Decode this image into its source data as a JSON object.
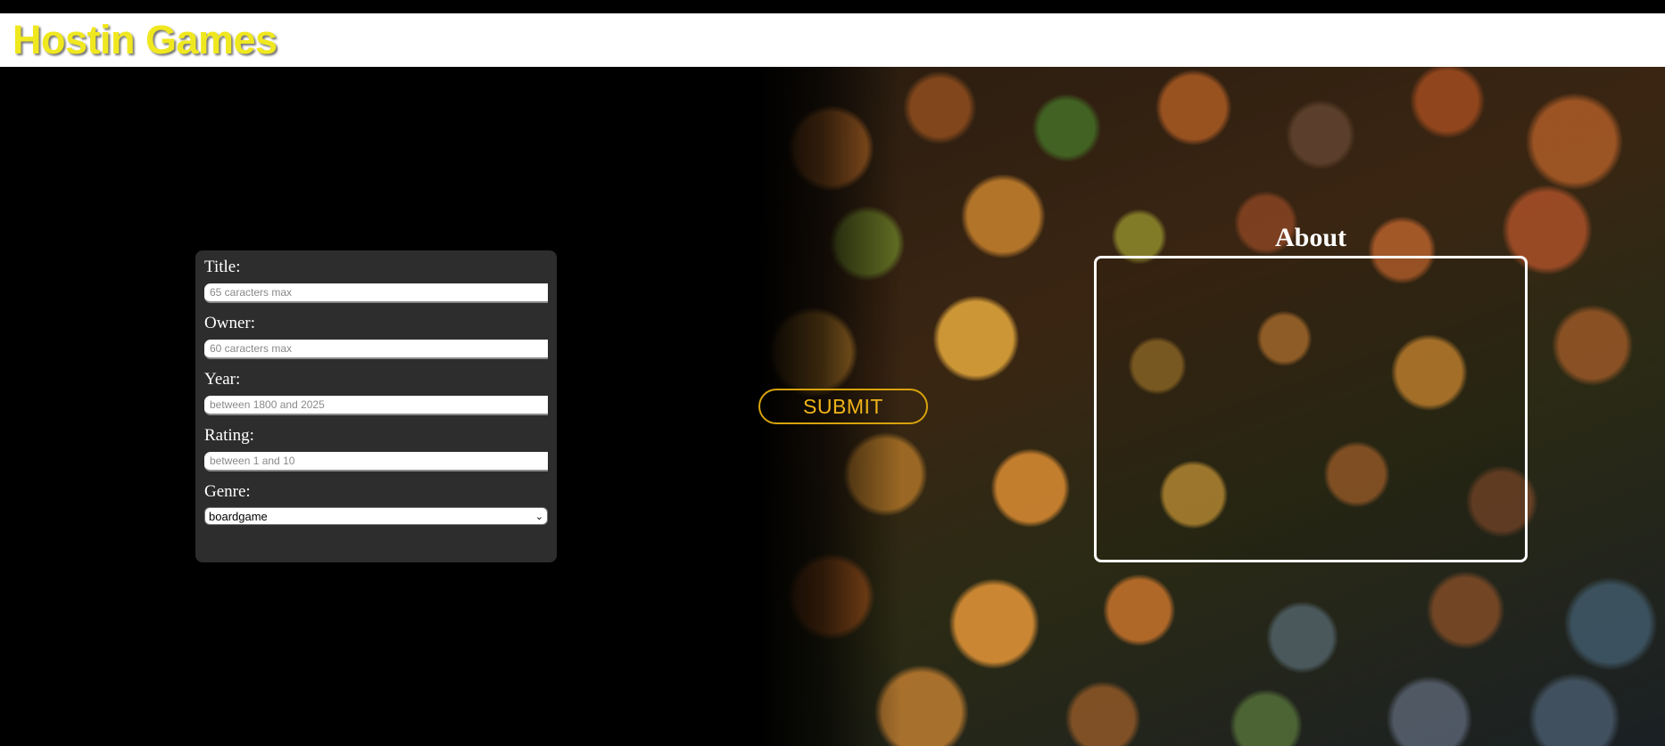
{
  "header": {
    "brand": "Hostin Games"
  },
  "form": {
    "title_label": "Title:",
    "title_placeholder": "65 caracters max",
    "owner_label": "Owner:",
    "owner_placeholder": "60 caracters max",
    "year_label": "Year:",
    "year_placeholder": "between 1800 and 2025",
    "rating_label": "Rating:",
    "rating_placeholder": "between 1 and 10",
    "genre_label": "Genre:",
    "genre_selected": "boardgame"
  },
  "submit": {
    "label": "SUBMIT"
  },
  "about": {
    "title": "About"
  },
  "colors": {
    "brand": "#f0e81e",
    "accent": "#d8a30c",
    "panel": "#2d2d2d"
  },
  "icons": {
    "genre_dropdown": "chevron-down-icon"
  }
}
